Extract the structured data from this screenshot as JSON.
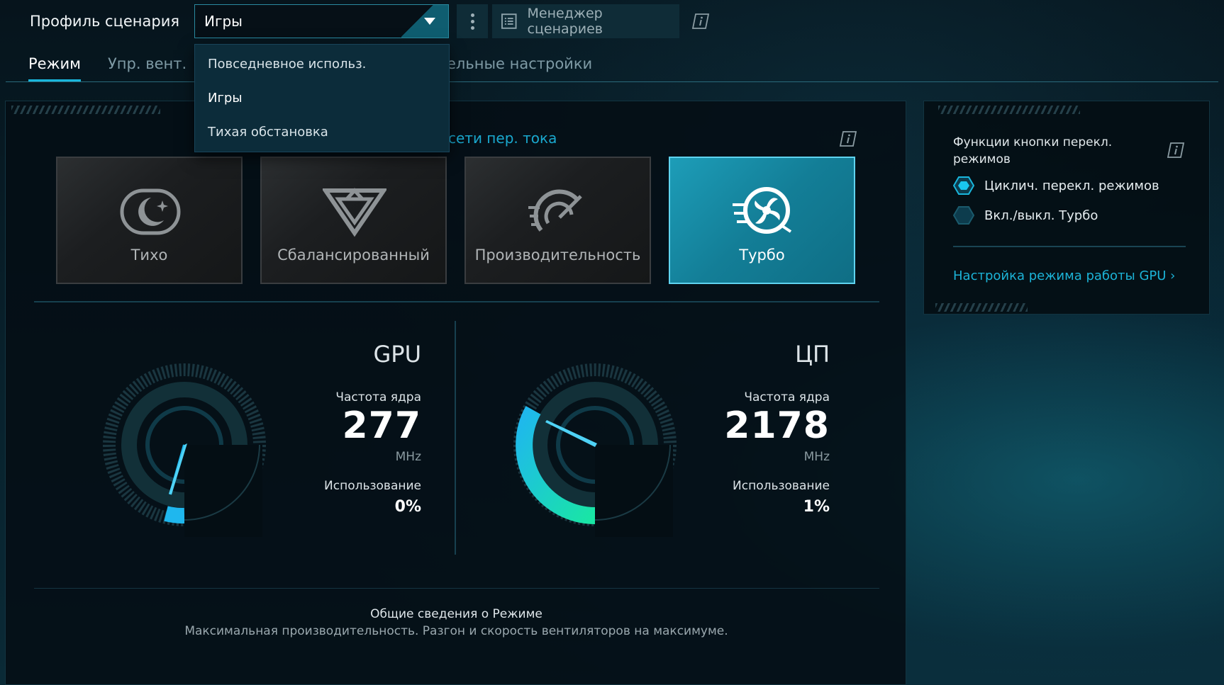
{
  "header": {
    "profile_label": "Профиль сценария",
    "profile_selected": "Игры",
    "manager_button": "Менеджер сценариев"
  },
  "tabs": [
    {
      "label": "Режим",
      "active": true
    },
    {
      "label": "Упр. вент.",
      "active": false
    },
    {
      "label": "ельные настройки",
      "active": false
    }
  ],
  "dropdown": {
    "options": [
      "Повседневное использ.",
      "Игры",
      "Тихая обстановка"
    ],
    "selected": "Игры"
  },
  "main": {
    "ac_label": "сети пер. тока",
    "modes": [
      {
        "label": "Тихо",
        "icon": "moon-icon",
        "active": false
      },
      {
        "label": "Сбалансированный",
        "icon": "balanced-icon",
        "active": false
      },
      {
        "label": "Производительность",
        "icon": "speedometer-icon",
        "active": false
      },
      {
        "label": "Турбо",
        "icon": "turbo-fan-icon",
        "active": true
      }
    ],
    "gpu": {
      "title": "GPU",
      "freq_label": "Частота ядра",
      "freq_value": "277",
      "freq_unit": "MHz",
      "usage_label": "Использование",
      "usage_value": "0%"
    },
    "cpu": {
      "title": "ЦП",
      "freq_label": "Частота ядра",
      "freq_value": "2178",
      "freq_unit": "MHz",
      "usage_label": "Использование",
      "usage_value": "1%"
    },
    "summary": {
      "title": "Общие сведения о Режиме",
      "description": "Максимальная производительность. Разгон и скорость вентиляторов на максимуме."
    }
  },
  "side": {
    "title": "Функции кнопки перекл. режимов",
    "options": [
      {
        "label": "Циклич. перекл. режимов",
        "selected": true
      },
      {
        "label": "Вкл./выкл. Турбо",
        "selected": false
      }
    ],
    "gpu_link": "Настройка режима работы GPU"
  },
  "colors": {
    "accent": "#19b7dd",
    "turbo_card": "#1a93ad",
    "gauge_gradient_start": "#1fb7ee",
    "gauge_gradient_end": "#19e6a4"
  }
}
